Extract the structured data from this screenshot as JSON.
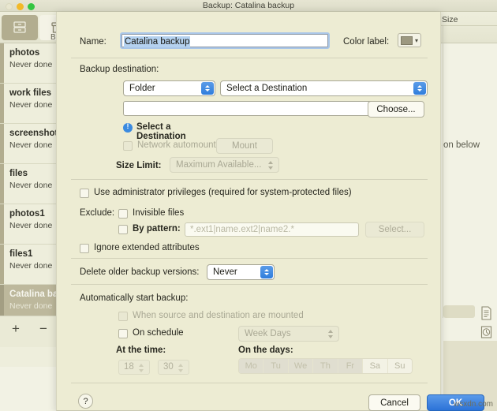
{
  "window": {
    "title": "Backup: Catalina backup",
    "traffic_lights": [
      "close",
      "minimize",
      "zoom"
    ],
    "toolbar": {
      "buttons": [
        {
          "name": "drawer-icon",
          "selected": true
        },
        {
          "name": "box-icon",
          "selected": false
        }
      ],
      "partial_label": "B"
    },
    "column_header_size": "Size",
    "background_hint": "on below",
    "watermark": "wsxdn.com"
  },
  "sidebar": {
    "items": [
      {
        "name": "photos",
        "status": "Never done",
        "selected": false
      },
      {
        "name": "work files",
        "status": "Never done",
        "selected": false
      },
      {
        "name": "screenshots",
        "status": "Never done",
        "selected": false
      },
      {
        "name": "files",
        "status": "Never done",
        "selected": false
      },
      {
        "name": "photos1",
        "status": "Never done",
        "selected": false
      },
      {
        "name": "files1",
        "status": "Never done",
        "selected": false
      },
      {
        "name": "Catalina backup",
        "status": "Never done",
        "selected": true
      }
    ],
    "add_label": "+",
    "remove_label": "−"
  },
  "sheet": {
    "name_label": "Name:",
    "name_value": "Catalina backup",
    "color_label": "Color label:",
    "color_swatch_hex": "#9c9880",
    "destination": {
      "section_label": "Backup destination:",
      "type_value": "Folder",
      "target_value": "Select a Destination",
      "path_value": "",
      "choose_label": "Choose...",
      "warning_text": "Select a Destination",
      "automount_label": "Network automount",
      "automount_checked": false,
      "mount_label": "Mount",
      "size_limit_label": "Size Limit:",
      "size_limit_value": "Maximum Available..."
    },
    "options": {
      "admin_label": "Use administrator privileges (required for system-protected files)",
      "admin_checked": false,
      "exclude_label": "Exclude:",
      "invisible_label": "Invisible files",
      "invisible_checked": false,
      "pattern_label": "By pattern:",
      "pattern_checked": false,
      "pattern_placeholder": "*.ext1|name.ext2|name2.*",
      "select_label": "Select...",
      "xattr_label": "Ignore extended attributes",
      "xattr_checked": false
    },
    "retention": {
      "label": "Delete older backup versions:",
      "value": "Never"
    },
    "schedule": {
      "section_label": "Automatically start backup:",
      "mounted_label": "When source and destination are mounted",
      "mounted_checked": false,
      "on_schedule_label": "On schedule",
      "on_schedule_checked": false,
      "frequency_value": "Week Days",
      "time_label": "At the time:",
      "hour": "18",
      "minute": "30",
      "days_label": "On the days:",
      "days": [
        {
          "label": "Mo",
          "on": true
        },
        {
          "label": "Tu",
          "on": true
        },
        {
          "label": "We",
          "on": true
        },
        {
          "label": "Th",
          "on": true
        },
        {
          "label": "Fr",
          "on": true
        },
        {
          "label": "Sa",
          "on": false
        },
        {
          "label": "Su",
          "on": false
        }
      ]
    },
    "footer": {
      "help_label": "?",
      "cancel_label": "Cancel",
      "ok_label": "OK"
    }
  }
}
